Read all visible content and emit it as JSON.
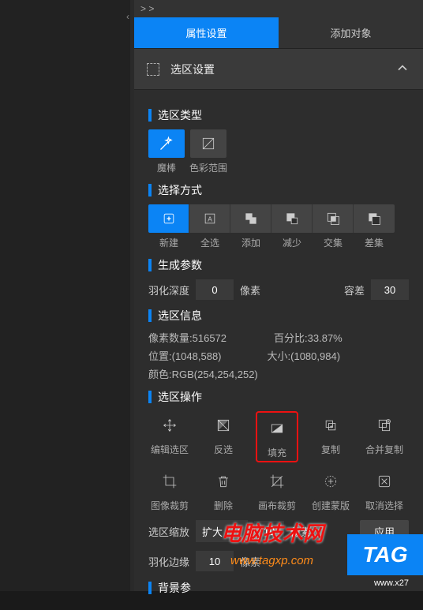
{
  "breadcrumb": "> >",
  "tabs": {
    "properties": "属性设置",
    "addObject": "添加对象"
  },
  "accordion": {
    "title": "选区设置"
  },
  "sections": {
    "type": {
      "title": "选区类型",
      "magicWand": "魔棒",
      "colorRange": "色彩范围"
    },
    "mode": {
      "title": "选择方式",
      "new": "新建",
      "all": "全选",
      "add": "添加",
      "sub": "减少",
      "intersect": "交集",
      "diff": "差集"
    },
    "gen": {
      "title": "生成参数",
      "featherDepth": "羽化深度",
      "featherVal": "0",
      "px": "像素",
      "tolerance": "容差",
      "tolVal": "30"
    },
    "info": {
      "title": "选区信息",
      "pixelCountLabel": "像素数量:",
      "pixelCount": "516572",
      "percentLabel": "百分比:",
      "percent": "33.87%",
      "posLabel": "位置:",
      "pos": "(1048,588)",
      "sizeLabel": "大小:",
      "size": "(1080,984)",
      "colorLabel": "颜色:",
      "color": "RGB(254,254,252)"
    },
    "ops": {
      "title": "选区操作",
      "editSel": "编辑选区",
      "invert": "反选",
      "fill": "填充",
      "copy": "复制",
      "mergeCopy": "合并复制",
      "imgCrop": "图像裁剪",
      "delete": "删除",
      "canvasCrop": "画布裁剪",
      "mask": "创建蒙版",
      "deselect": "取消选择",
      "zoomLabel": "选区缩放",
      "zoomMode": "扩大",
      "zoomVal": "10",
      "featherEdgeLabel": "羽化边缘",
      "featherEdgeVal": "10",
      "apply": "应用"
    },
    "bg": {
      "title": "背景参"
    }
  },
  "watermark": {
    "text1": "电脑技术网",
    "text2": "www.tagxp.com",
    "tag": "TAG",
    "tagUrl": "www.x27"
  }
}
